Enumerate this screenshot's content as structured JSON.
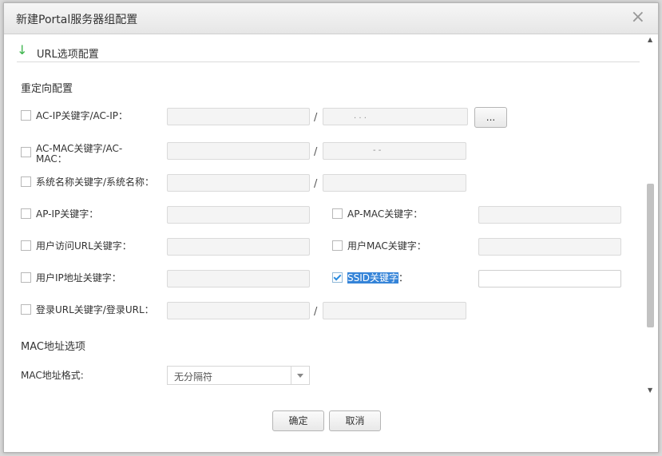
{
  "dialog": {
    "title": "新建Portal服务器组配置",
    "close": "×"
  },
  "section": {
    "title": "URL选项配置",
    "redirect_title": "重定向配置",
    "mac_title": "MAC地址选项"
  },
  "rows": {
    "acip": {
      "label": "AC-IP关键字/AC-IP：",
      "checked": false,
      "sep": "/",
      "ip_dots": ".    .    .",
      "browse": "..."
    },
    "acmac": {
      "label1": "AC-MAC关键字/AC-",
      "label2": "MAC：",
      "checked": false,
      "sep": "/",
      "mac_dashes": "-        -"
    },
    "sysname": {
      "label": "系统名称关键字/系统名称：",
      "checked": false,
      "sep": "/"
    },
    "apip": {
      "label": "AP-IP关键字：",
      "checked": false
    },
    "apmac": {
      "label": "AP-MAC关键字：",
      "checked": false
    },
    "userurl": {
      "label": "用户访问URL关键字：",
      "checked": false
    },
    "usermac": {
      "label": "用户MAC关键字：",
      "checked": false
    },
    "userip": {
      "label": "用户IP地址关键字：",
      "checked": false
    },
    "ssid": {
      "label": "SSID关键字",
      "suffix": "：",
      "checked": true,
      "value": ""
    },
    "login": {
      "label": "登录URL关键字/登录URL：",
      "checked": false,
      "sep": "/"
    }
  },
  "mac": {
    "format_label": "MAC地址格式:",
    "format_value": "无分隔符"
  },
  "footer": {
    "ok": "确定",
    "cancel": "取消"
  }
}
